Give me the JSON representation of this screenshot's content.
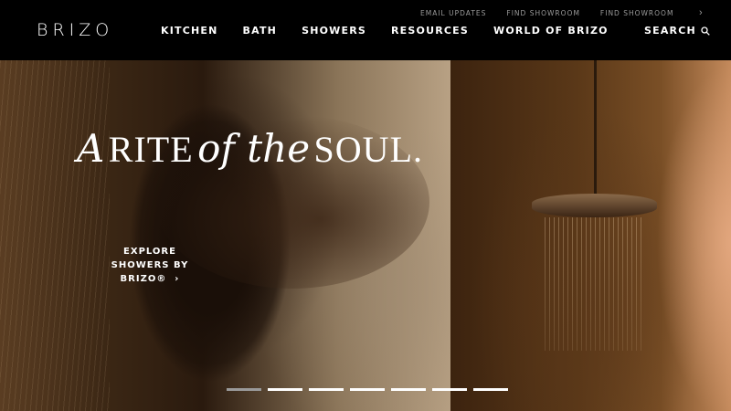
{
  "header": {
    "logo": "BRIZO",
    "nav": [
      "KITCHEN",
      "BATH",
      "SHOWERS",
      "RESOURCES",
      "WORLD OF BRIZO"
    ],
    "utility": [
      "EMAIL UPDATES",
      "FIND SHOWROOM",
      "FIND SHOWROOM"
    ],
    "search_label": "SEARCH"
  },
  "hero": {
    "headline_script_1": "A",
    "headline_caps_1": "RITE",
    "headline_script_2": "of the",
    "headline_caps_2": "SOUL.",
    "cta_line1": "EXPLORE SHOWERS BY",
    "cta_line2": "BRIZO®"
  },
  "carousel": {
    "count": 7,
    "active_index": 0
  },
  "colors": {
    "header_bg": "#000000",
    "text": "#ffffff",
    "utility_text": "#9a9a9a",
    "dot_inactive": "#ffffff",
    "dot_active": "#9a9a9a"
  },
  "icons": {
    "search": "search-icon",
    "chevron": "chevron-right-icon"
  }
}
